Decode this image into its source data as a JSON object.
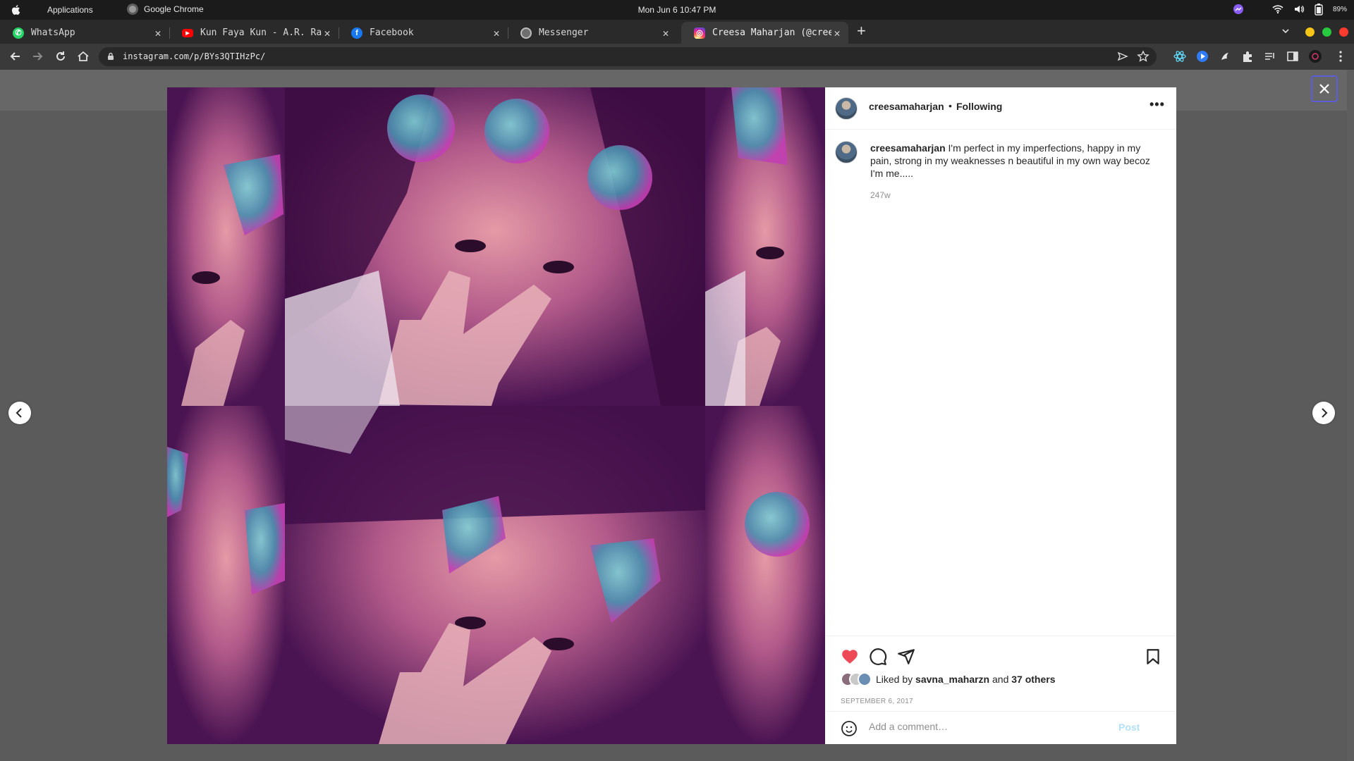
{
  "os_bar": {
    "applications_label": "Applications",
    "app_name": "Google Chrome",
    "clock": "Mon Jun 6  10:47 PM",
    "battery_percent": "89%"
  },
  "tabs": [
    {
      "label": "WhatsApp",
      "icon": "whatsapp-icon",
      "color": "#25d366"
    },
    {
      "label": "Kun Faya Kun - A.R. Ra",
      "icon": "youtube-icon",
      "color": "#ff0000"
    },
    {
      "label": "Facebook",
      "icon": "facebook-icon",
      "color": "#1877f2"
    },
    {
      "label": "Messenger",
      "icon": "globe-icon",
      "color": "#9a9a9a"
    },
    {
      "label": "Creesa Maharjan (@cree",
      "icon": "instagram-icon",
      "color": "#e1306c"
    }
  ],
  "address": {
    "url": "instagram.com/p/BYs3QTIHzPc/"
  },
  "post": {
    "username": "creesamaharjan",
    "separator": "•",
    "follow_status": "Following",
    "more": "•••",
    "caption_user": "creesamaharjan",
    "caption_text": "I'm perfect in my imperfections, happy in my pain, strong in my weaknesses n beautiful in my own way becoz I'm me.....",
    "age": "247w",
    "liked_by_prefix": "Liked by",
    "liked_by_user": "savna_maharzn",
    "liked_by_and": "and",
    "liked_by_others": "37 others",
    "date": "SEPTEMBER 6, 2017",
    "comment_placeholder": "Add a comment…",
    "post_button": "Post",
    "liked": true
  },
  "colors": {
    "like_red": "#ed4956",
    "post_button_disabled": "#b2dffc",
    "close_focus": "#5b5ed6"
  }
}
